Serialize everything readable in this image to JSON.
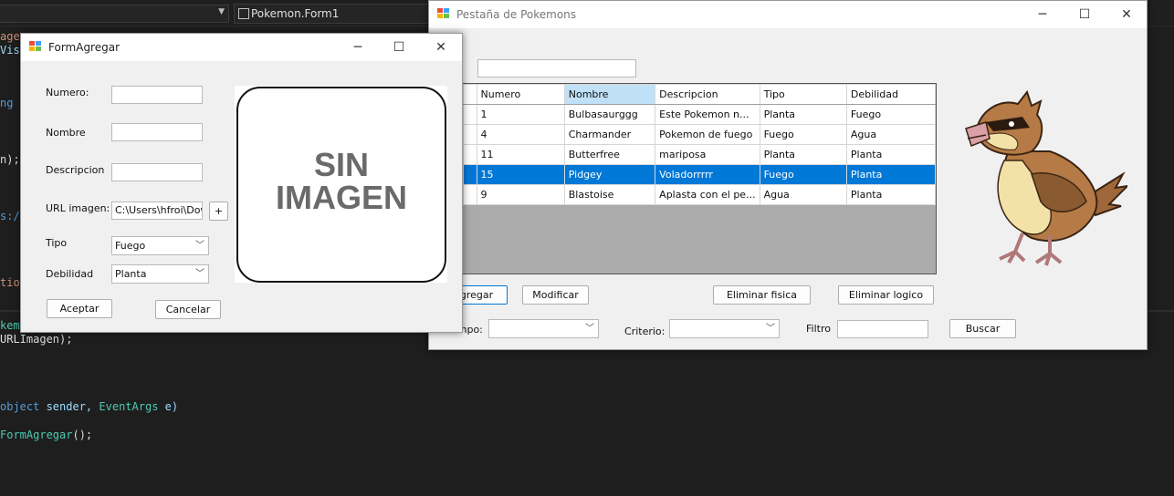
{
  "ide": {
    "tab_title": "Pokemon.Form1",
    "code_lines": [
      {
        "parts": [
          {
            "t": "agen",
            "c": "st"
          },
          {
            "t": "",
            "c": ""
          }
        ]
      },
      {
        "parts": [
          {
            "t": "Visi",
            "c": "tx"
          }
        ]
      },
      {
        "parts": [
          {
            "t": "ng i",
            "c": "kw"
          }
        ]
      },
      {
        "parts": [
          {
            "t": "n);",
            "c": ""
          }
        ]
      },
      {
        "parts": [
          {
            "t": "s://",
            "c": "kw"
          }
        ]
      },
      {
        "parts": [
          {
            "t": "tion",
            "c": "st"
          }
        ]
      },
      {
        "parts": [
          {
            "t": "kemo",
            "c": "ty"
          }
        ]
      },
      {
        "parts": [
          {
            "t": "URLImagen);",
            "c": ""
          }
        ]
      },
      {
        "parts": [
          {
            "t": "object",
            "c": "kw"
          },
          {
            "t": " sender, ",
            "c": "tx"
          },
          {
            "t": "EventArgs",
            "c": "ty"
          },
          {
            "t": " e)",
            "c": "tx"
          }
        ]
      },
      {
        "parts": [
          {
            "t": "FormAgregar",
            "c": "ty"
          },
          {
            "t": "();",
            "c": ""
          }
        ]
      }
    ]
  },
  "main_window": {
    "title": "Pestaña de Pokemons",
    "search_label": ":",
    "search_value": "",
    "grid": {
      "columns": [
        "Numero",
        "Nombre",
        "Descripcion",
        "Tipo",
        "Debilidad"
      ],
      "selected_column": 1,
      "rows": [
        [
          "1",
          "Bulbasaurggg",
          "Este Pokemon n...",
          "Planta",
          "Fuego"
        ],
        [
          "4",
          "Charmander",
          "Pokemon de fuego",
          "Fuego",
          "Agua"
        ],
        [
          "11",
          "Butterfree",
          "mariposa",
          "Planta",
          "Planta"
        ],
        [
          "15",
          "Pidgey",
          "Voladorrrrr",
          "Fuego",
          "Planta"
        ],
        [
          "9",
          "Blastoise",
          "Aplasta con el pe...",
          "Agua",
          "Planta"
        ]
      ],
      "selected_row": 3
    },
    "buttons": {
      "agregar": "gregar",
      "modificar": "Modificar",
      "eliminar_fisica": "Eliminar fisica",
      "eliminar_logico": "Eliminar logico",
      "buscar": "Buscar"
    },
    "filters": {
      "campo_label": "ampo:",
      "campo_value": "",
      "criterio_label": "Criterio:",
      "criterio_value": "",
      "filtro_label": "Filtro",
      "filtro_value": ""
    },
    "image_name": "pidgey-image"
  },
  "form_agregar": {
    "title": "FormAgregar",
    "labels": {
      "numero": "Numero:",
      "nombre": "Nombre",
      "descripcion": "Descripcion",
      "url": "URL imagen:",
      "tipo": "Tipo",
      "debilidad": "Debilidad"
    },
    "values": {
      "numero": "",
      "nombre": "",
      "descripcion": "",
      "url": "C:\\Users\\hfroi\\Dow",
      "tipo": "Fuego",
      "debilidad": "Planta"
    },
    "plus_button": "+",
    "aceptar": "Aceptar",
    "cancelar": "Cancelar",
    "placeholder_image": {
      "line1": "SIN",
      "line2": "IMAGEN"
    }
  },
  "colors": {
    "selection": "#0078d7",
    "header_selected": "#bfe0f7",
    "window_bg": "#f0f0f0",
    "ide_bg": "#1e1e1e"
  }
}
